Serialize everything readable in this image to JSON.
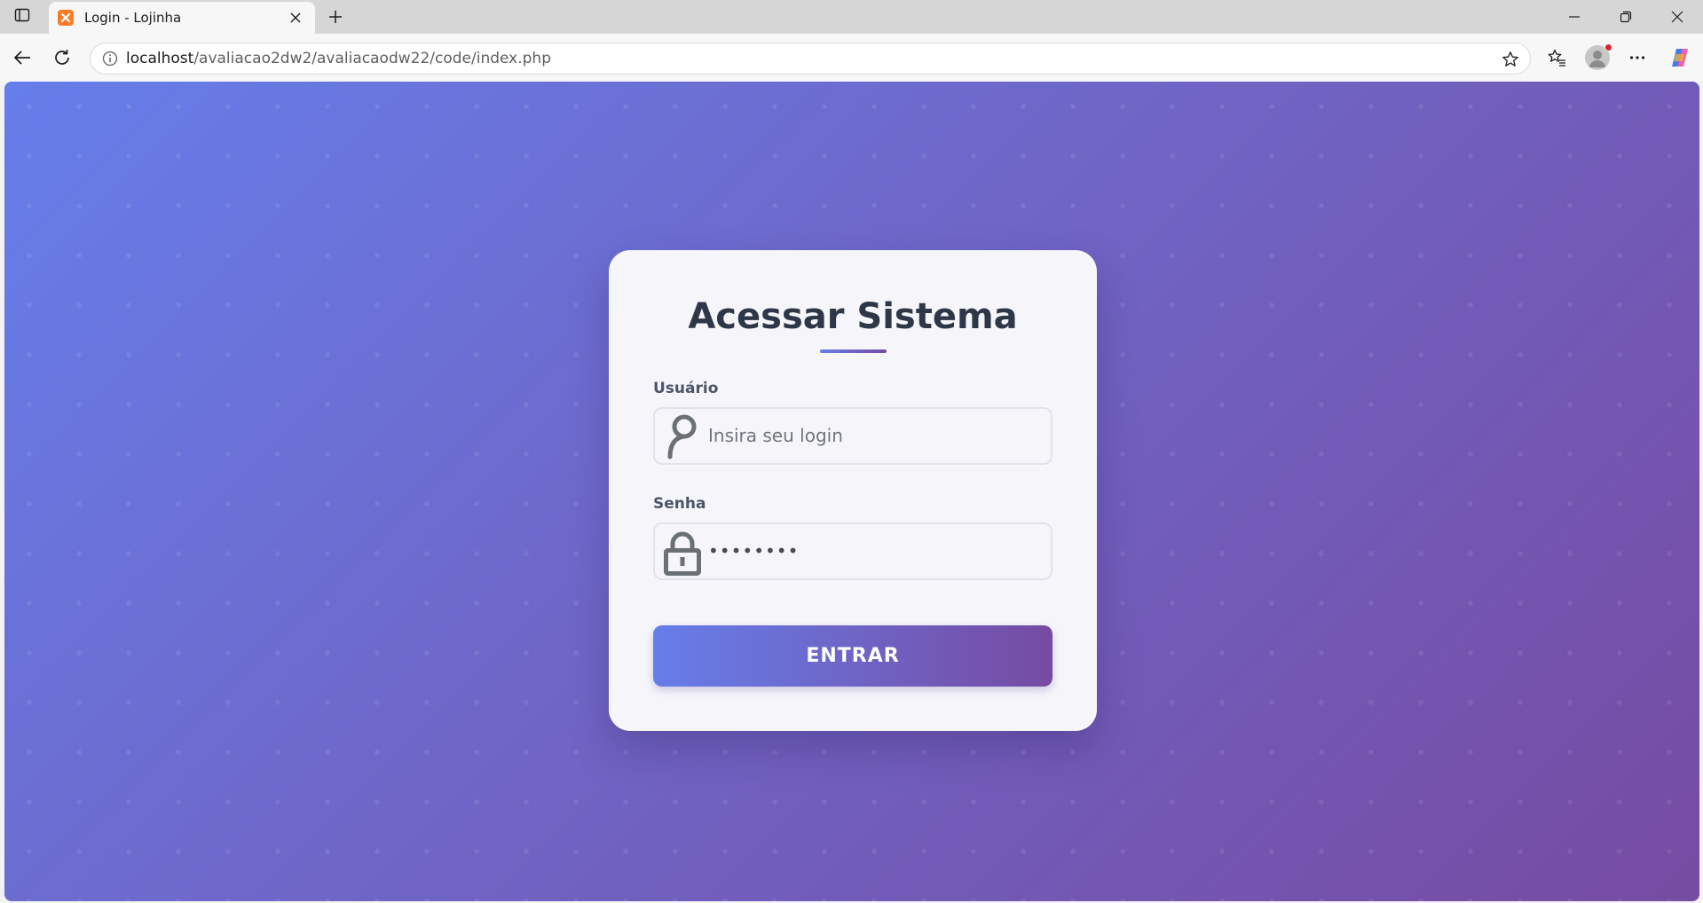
{
  "browser": {
    "tab": {
      "title": "Login - Lojinha",
      "favicon": "xampp-icon"
    },
    "address": {
      "host": "localhost",
      "path": "/avaliacao2dw2/avaliacaodw22/code/index.php"
    },
    "icons": {
      "tab_actions": "tab-actions-icon",
      "new_tab": "plus-icon",
      "back": "back-arrow-icon",
      "reload": "reload-icon",
      "site_info": "info-icon",
      "favorite": "star-icon",
      "favorites": "favorites-icon",
      "profile": "profile-icon",
      "more": "more-icon",
      "copilot": "copilot-icon",
      "minimize": "minimize-icon",
      "restore": "restore-icon",
      "close": "close-icon"
    }
  },
  "login": {
    "title": "Acessar Sistema",
    "user_label": "Usuário",
    "user_placeholder": "Insira seu login",
    "password_label": "Senha",
    "password_value": "••••••••",
    "submit_label": "ENTRAR"
  },
  "colors": {
    "gradient_start": "#667eea",
    "gradient_end": "#764ba2",
    "card_background": "#f6f6fa",
    "title_color": "#2d3748"
  }
}
